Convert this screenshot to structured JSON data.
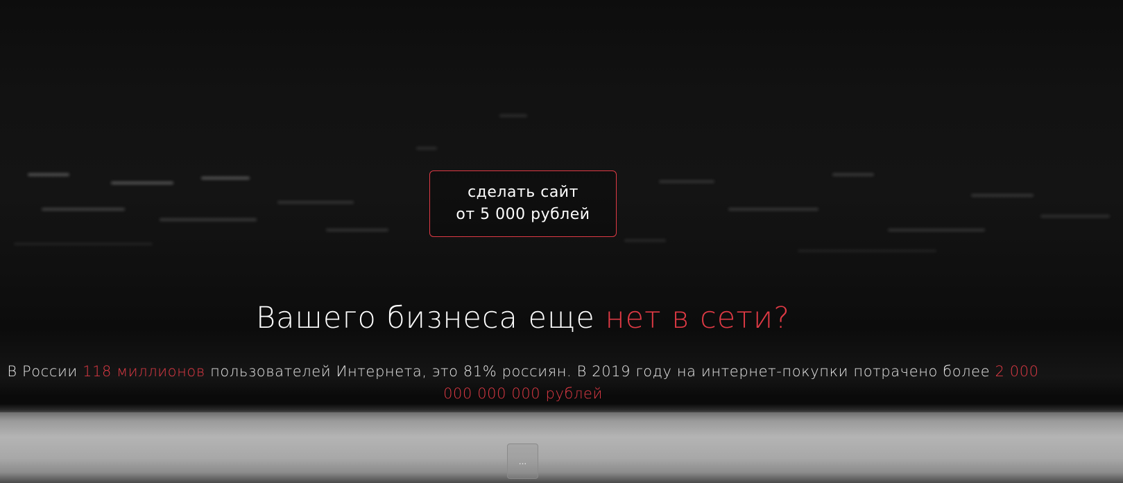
{
  "cta": {
    "line1": "сделать сайт",
    "line2": "от 5 000 рублей"
  },
  "headline": {
    "part1": "Вашего бизнеса еще ",
    "accent": "нет в сети?"
  },
  "subtext": {
    "t1": "В России ",
    "a1": "118 миллионов",
    "t2": " пользователей Интернета, это 81% россиян. В 2019 году на интернет-покупки потрачено более ",
    "a2": "2 000 000 000 000 рублей"
  },
  "more_button": {
    "label": "..."
  },
  "colors": {
    "accent": "#e03a45",
    "background": "#0b0b0b",
    "text": "#ffffff"
  }
}
